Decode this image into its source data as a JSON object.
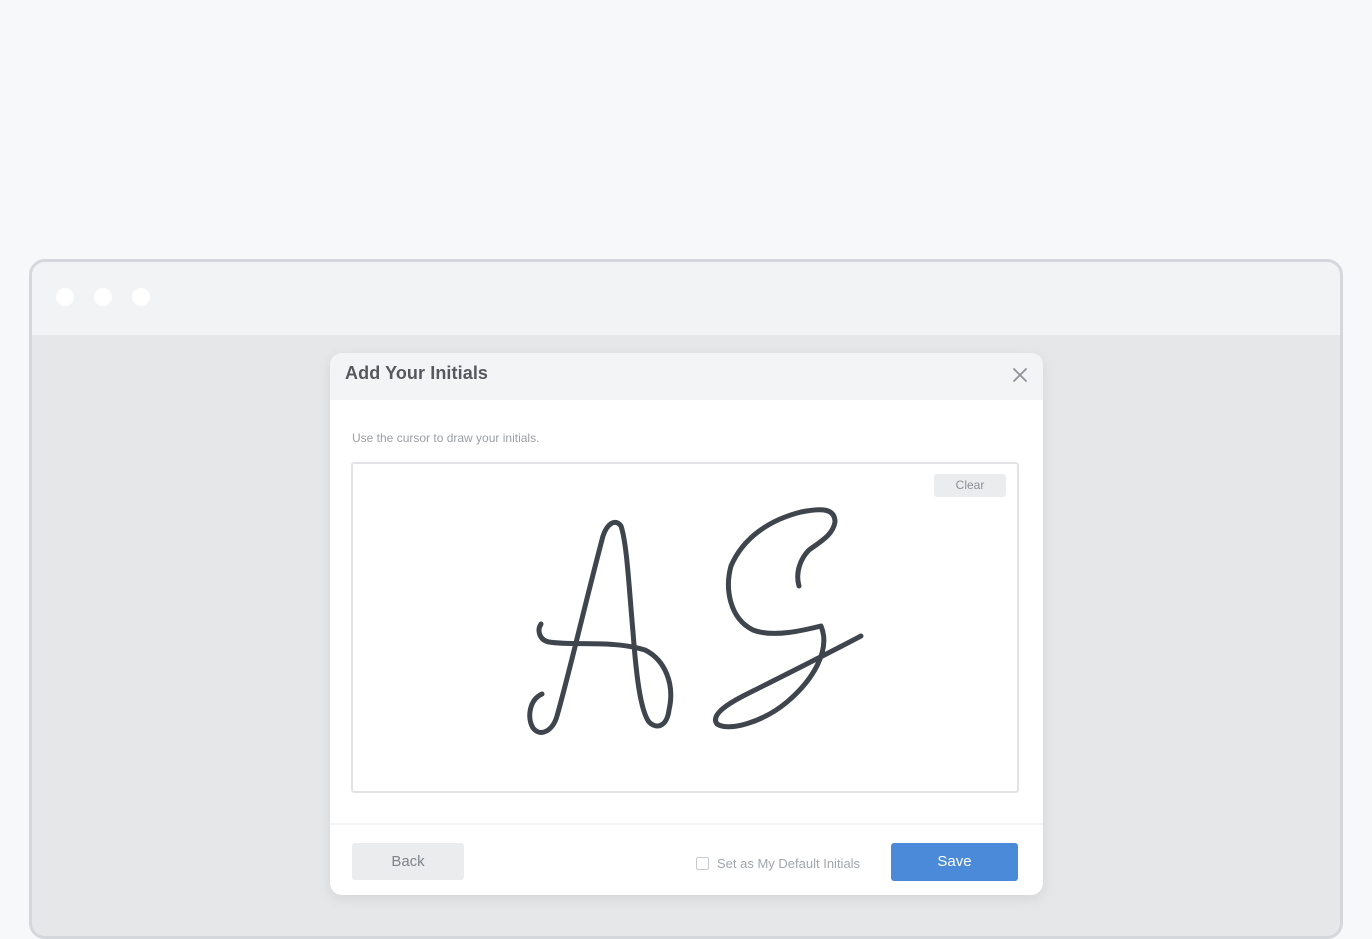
{
  "modal": {
    "title": "Add Your Initials",
    "instruction": "Use the cursor to draw your initials.",
    "clear_label": "Clear",
    "back_label": "Back",
    "default_checkbox_label": "Set as My Default Initials",
    "default_checked": false,
    "save_label": "Save"
  },
  "icons": {
    "close": "close-icon"
  },
  "colors": {
    "accent": "#4a8ad8",
    "ink": "#3f454d"
  }
}
